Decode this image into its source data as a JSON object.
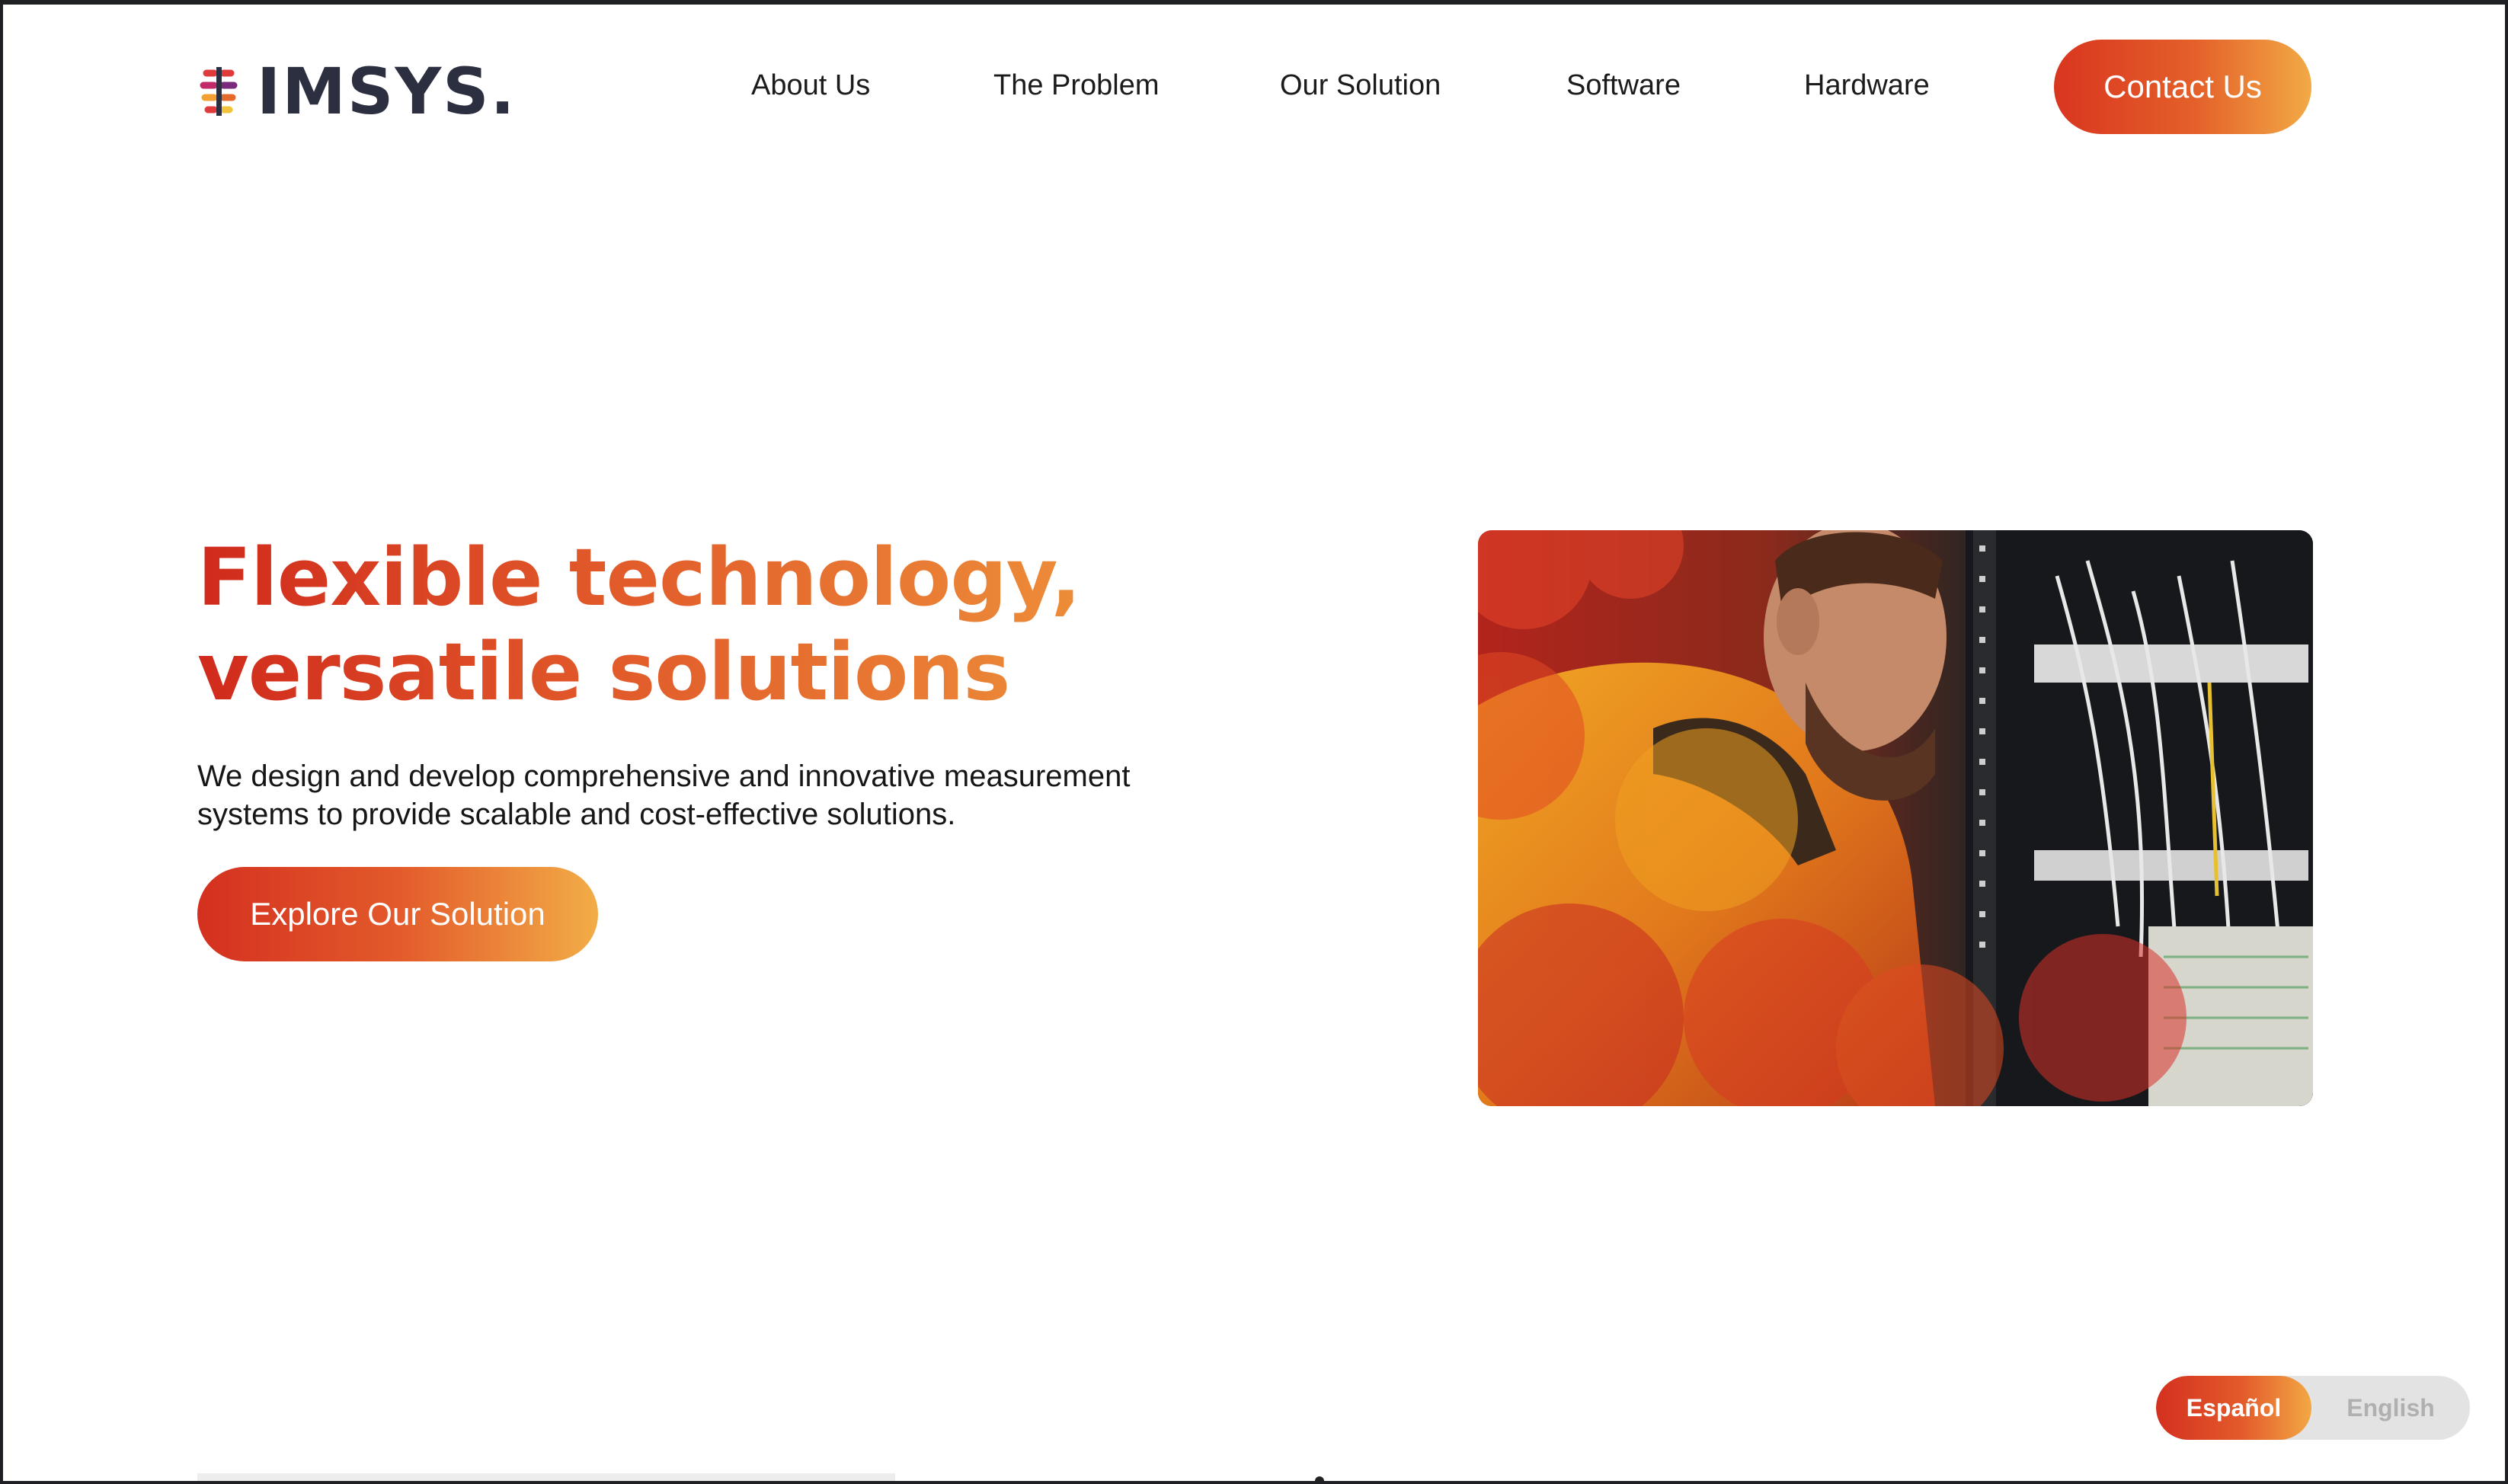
{
  "brand": {
    "name": "IMSYS.",
    "logo_icon": "dot-grid-logo-mark",
    "text_color": "#2b2f3f"
  },
  "nav": {
    "items": [
      {
        "label": "About Us"
      },
      {
        "label": "The Problem"
      },
      {
        "label": "Our Solution"
      },
      {
        "label": "Software"
      },
      {
        "label": "Hardware"
      }
    ],
    "cta_label": "Contact Us"
  },
  "hero": {
    "title_line1": "Flexible technology,",
    "title_line2": "versatile solutions",
    "subtitle_line1": "We design and develop comprehensive and innovative measurement",
    "subtitle_line2": "systems to provide scalable and cost-effective solutions.",
    "cta_label": "Explore Our Solution",
    "image_icon": "technician-server-rack-photo"
  },
  "language": {
    "active": "Español",
    "inactive": "English"
  },
  "colors": {
    "accent_start": "#d9351f",
    "accent_mid": "#e4602a",
    "accent_end": "#f2aa45",
    "text": "#161616"
  }
}
